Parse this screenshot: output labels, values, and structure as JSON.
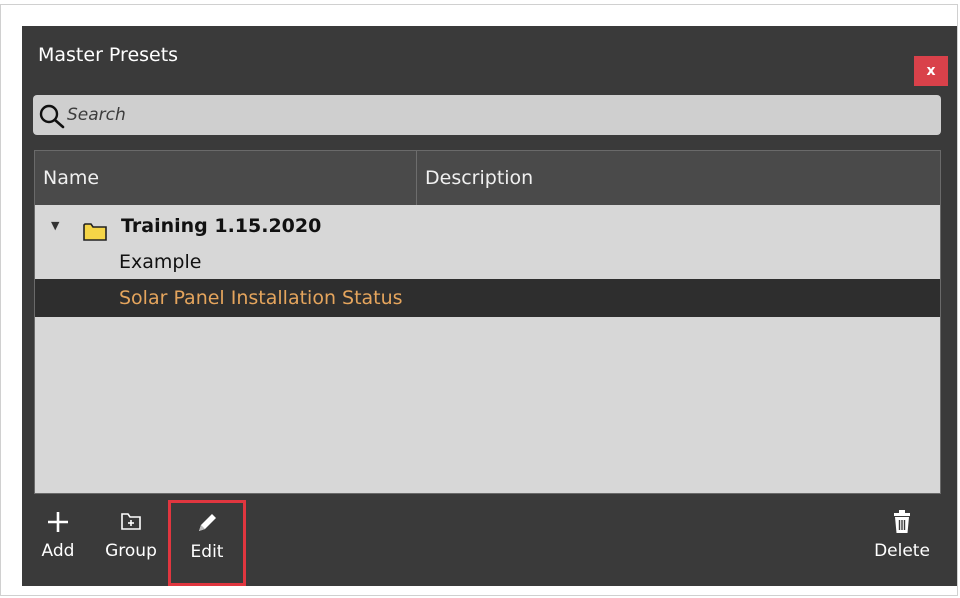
{
  "dialog": {
    "title": "Master Presets",
    "close_label": "x"
  },
  "search": {
    "placeholder": "Search",
    "value": ""
  },
  "table": {
    "columns": [
      "Name",
      "Description"
    ],
    "group": {
      "label": "Training 1.15.2020",
      "expanded": true
    },
    "items": [
      {
        "name": "Example",
        "description": "",
        "selected": false
      },
      {
        "name": "Solar Panel Installation Status",
        "description": "",
        "selected": true
      }
    ]
  },
  "toolbar": {
    "add_label": "Add",
    "group_label": "Group",
    "edit_label": "Edit",
    "delete_label": "Delete",
    "icons": {
      "add": "plus-icon",
      "group": "folder-plus-icon",
      "edit": "pencil-icon",
      "delete": "trash-icon"
    }
  },
  "colors": {
    "panel_bg": "#3a3a3a",
    "close_bg": "#d9414a",
    "selected_text": "#e5a55d",
    "highlight_border": "#e0363f",
    "folder": "#f5d547"
  }
}
